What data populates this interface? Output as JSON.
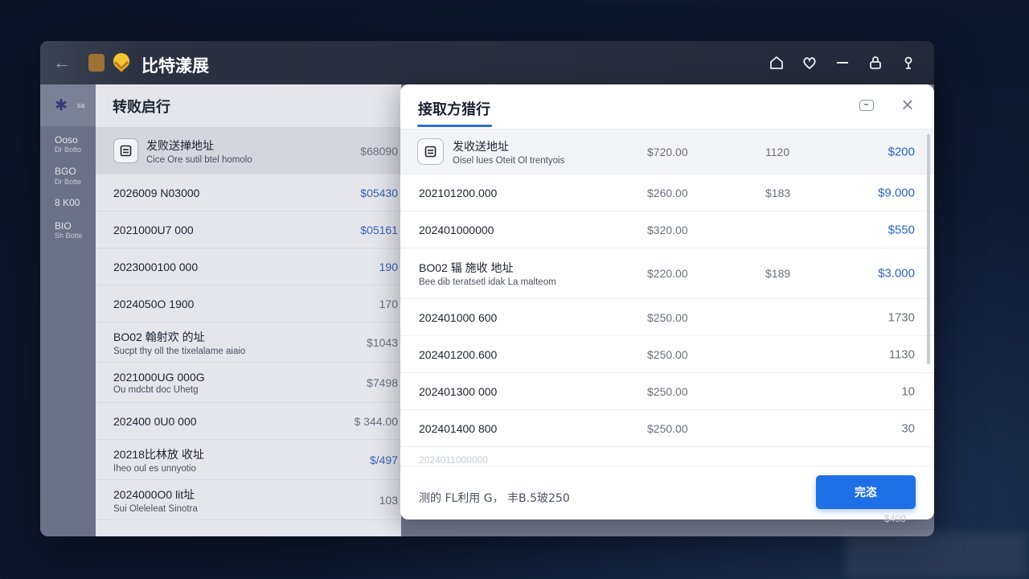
{
  "app": {
    "title": "比特漾展",
    "accent_color": "#1f6fe6",
    "logo_color": "#f3c531",
    "top_icons": [
      "home-icon",
      "heart-icon",
      "minimize-icon",
      "lock-icon",
      "user-icon"
    ]
  },
  "side_strip": {
    "items": [
      {
        "main": "Ooso",
        "sub": "Dr Botto"
      },
      {
        "main": "BGO",
        "sub": "Dr Botte"
      },
      {
        "main": "8 K00",
        "sub": ""
      },
      {
        "main": "BIO",
        "sub": "Sh Botte"
      }
    ]
  },
  "left_panel": {
    "title": "转败启行",
    "rows": [
      {
        "main": "发败送掸地址",
        "sub": "Cice Ore sutil btel homolo",
        "amount": "$68090",
        "highlight": true
      },
      {
        "main": "2026009 N03000",
        "sub": "",
        "amount": "$05430",
        "blue": true
      },
      {
        "main": "2021000U7 000",
        "sub": "",
        "amount": "$05161",
        "blue": true
      },
      {
        "main": "2023000100 000",
        "sub": "",
        "amount": "190",
        "blue": true
      },
      {
        "main": "2024050O 1900",
        "sub": "",
        "amount": "170"
      },
      {
        "main": "BO02 翰射欢 的址",
        "sub": "Sucpt thy oll the tixelalame aiaio",
        "amount": "$1043"
      },
      {
        "main": "2021000UG 000G",
        "sub": "Ou mdcbt doc Uhetg",
        "amount": "$7498"
      },
      {
        "main": "202400 0U0 000",
        "sub": "",
        "amount": "$ 344.00"
      },
      {
        "main": "20218比林放 收址",
        "sub": "Iheo oul es unnyotio",
        "amount": "$/497",
        "blue": true
      },
      {
        "main": "2024000O0 lit址",
        "sub": "Sui Oleleleat Sinotra",
        "amount": "103"
      }
    ]
  },
  "modal": {
    "title": "接取方猎行",
    "rows": [
      {
        "main": "发收送地址",
        "sub": "Oisel lues Oteit Ol trentyois",
        "c2": "$720.00",
        "c3": "1120",
        "c4": "$200",
        "blue": true,
        "highlight": true
      },
      {
        "main": "202101200.000",
        "sub": "",
        "c2": "$260.00",
        "c3": "$183",
        "c4": "$9.000",
        "blue": true
      },
      {
        "main": "202401000000",
        "sub": "",
        "c2": "$320.00",
        "c3": "",
        "c4": "$550",
        "blue": true
      },
      {
        "main": "BO02 辐 施收 地址",
        "sub": "Bee dib teratsetl idak La malteom",
        "c2": "$220.00",
        "c3": "$189",
        "c4": "$3.000",
        "blue": true,
        "two": true
      },
      {
        "main": "202401000 600",
        "sub": "",
        "c2": "$250.00",
        "c3": "",
        "c4": "1730"
      },
      {
        "main": "202401200.600",
        "sub": "",
        "c2": "$250.00",
        "c3": "",
        "c4": "1130"
      },
      {
        "main": "202401300 000",
        "sub": "",
        "c2": "$250.00",
        "c3": "",
        "c4": "10"
      },
      {
        "main": "202401400 800",
        "sub": "",
        "c2": "$250.00",
        "c3": "",
        "c4": "30"
      },
      {
        "main": "2024011000000",
        "sub": "",
        "c2": "",
        "c3": "",
        "c4": "",
        "faded": true
      }
    ],
    "footer_text": "测的  FL利用 G，  丰B.5玻250",
    "done_label": "完恣"
  },
  "outside": {
    "right_ghost_amount": "$400"
  }
}
